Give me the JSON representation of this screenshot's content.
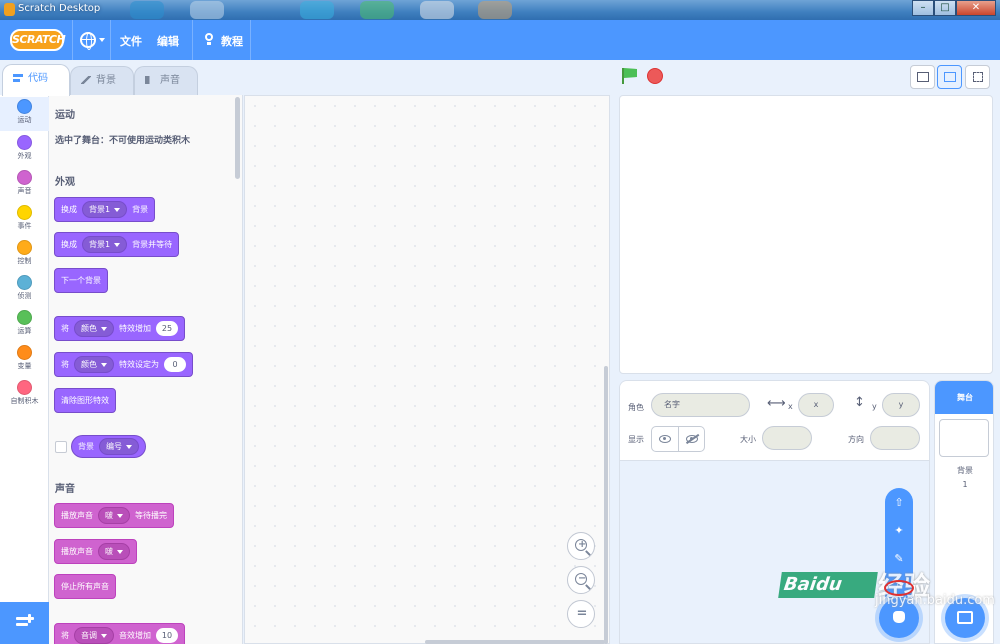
{
  "window": {
    "title": "Scratch Desktop",
    "controls": {
      "minimize": "–",
      "maximize": "□",
      "close": "✕"
    }
  },
  "menubar": {
    "logo_text": "SCRATCH",
    "language_icon": "globe-icon",
    "file": "文件",
    "edit": "编辑",
    "tutorials": "教程"
  },
  "tabs": [
    {
      "label": "代码",
      "icon": "code-icon",
      "active": true
    },
    {
      "label": "背景",
      "icon": "brush-icon",
      "active": false
    },
    {
      "label": "声音",
      "icon": "speaker-icon",
      "active": false
    }
  ],
  "categories": [
    {
      "label": "运动",
      "color": "#4c97ff",
      "active": true
    },
    {
      "label": "外观",
      "color": "#9966ff",
      "active": false
    },
    {
      "label": "声音",
      "color": "#cf63cf",
      "active": false
    },
    {
      "label": "事件",
      "color": "#ffd500",
      "active": false
    },
    {
      "label": "控制",
      "color": "#ffab19",
      "active": false
    },
    {
      "label": "侦测",
      "color": "#5cb1d6",
      "active": false
    },
    {
      "label": "运算",
      "color": "#59c059",
      "active": false
    },
    {
      "label": "变量",
      "color": "#ff8c1a",
      "active": false
    },
    {
      "label": "自制积木",
      "color": "#ff6680",
      "active": false
    }
  ],
  "palette": {
    "motion_head": "运动",
    "motion_note": "选中了舞台：不可使用运动类积木",
    "looks_head": "外观",
    "sound_head": "声音",
    "looks_blocks": {
      "switch_backdrop": {
        "a": "换成",
        "dd": "背景1",
        "b": "背景"
      },
      "switch_backdrop_wait": {
        "a": "换成",
        "dd": "背景1",
        "b": "背景并等待"
      },
      "next_backdrop": "下一个背景",
      "change_effect": {
        "a": "将",
        "dd": "颜色",
        "b": "特效增加",
        "val": "25"
      },
      "set_effect": {
        "a": "将",
        "dd": "颜色",
        "b": "特效设定为",
        "val": "0"
      },
      "clear_effects": "清除图形特效",
      "backdrop_reporter": {
        "a": "背景",
        "dd": "编号"
      }
    },
    "sound_blocks": {
      "play_until_done": {
        "a": "播放声音",
        "dd": "啵",
        "b": "等待播完"
      },
      "start_sound": {
        "a": "播放声音",
        "dd": "啵"
      },
      "stop_all": "停止所有声音",
      "change_effect": {
        "a": "将",
        "dd": "音调",
        "b": "音效增加",
        "val": "10"
      }
    }
  },
  "zoom": {
    "zoom_in": "+",
    "zoom_out": "−",
    "reset": "="
  },
  "sprite_info": {
    "sprite_label": "角色",
    "name_placeholder": "名字",
    "x_label": "x",
    "x_placeholder": "x",
    "y_label": "y",
    "y_placeholder": "y",
    "show_label": "显示",
    "size_label": "大小",
    "direction_label": "方向"
  },
  "target_pane": {
    "header": "舞台",
    "backdrops_label": "背景",
    "backdrops_count": "1"
  },
  "watermark": {
    "brand": "Baidu",
    "jingyan": "经验",
    "url": "jingyan.baidu.com"
  }
}
